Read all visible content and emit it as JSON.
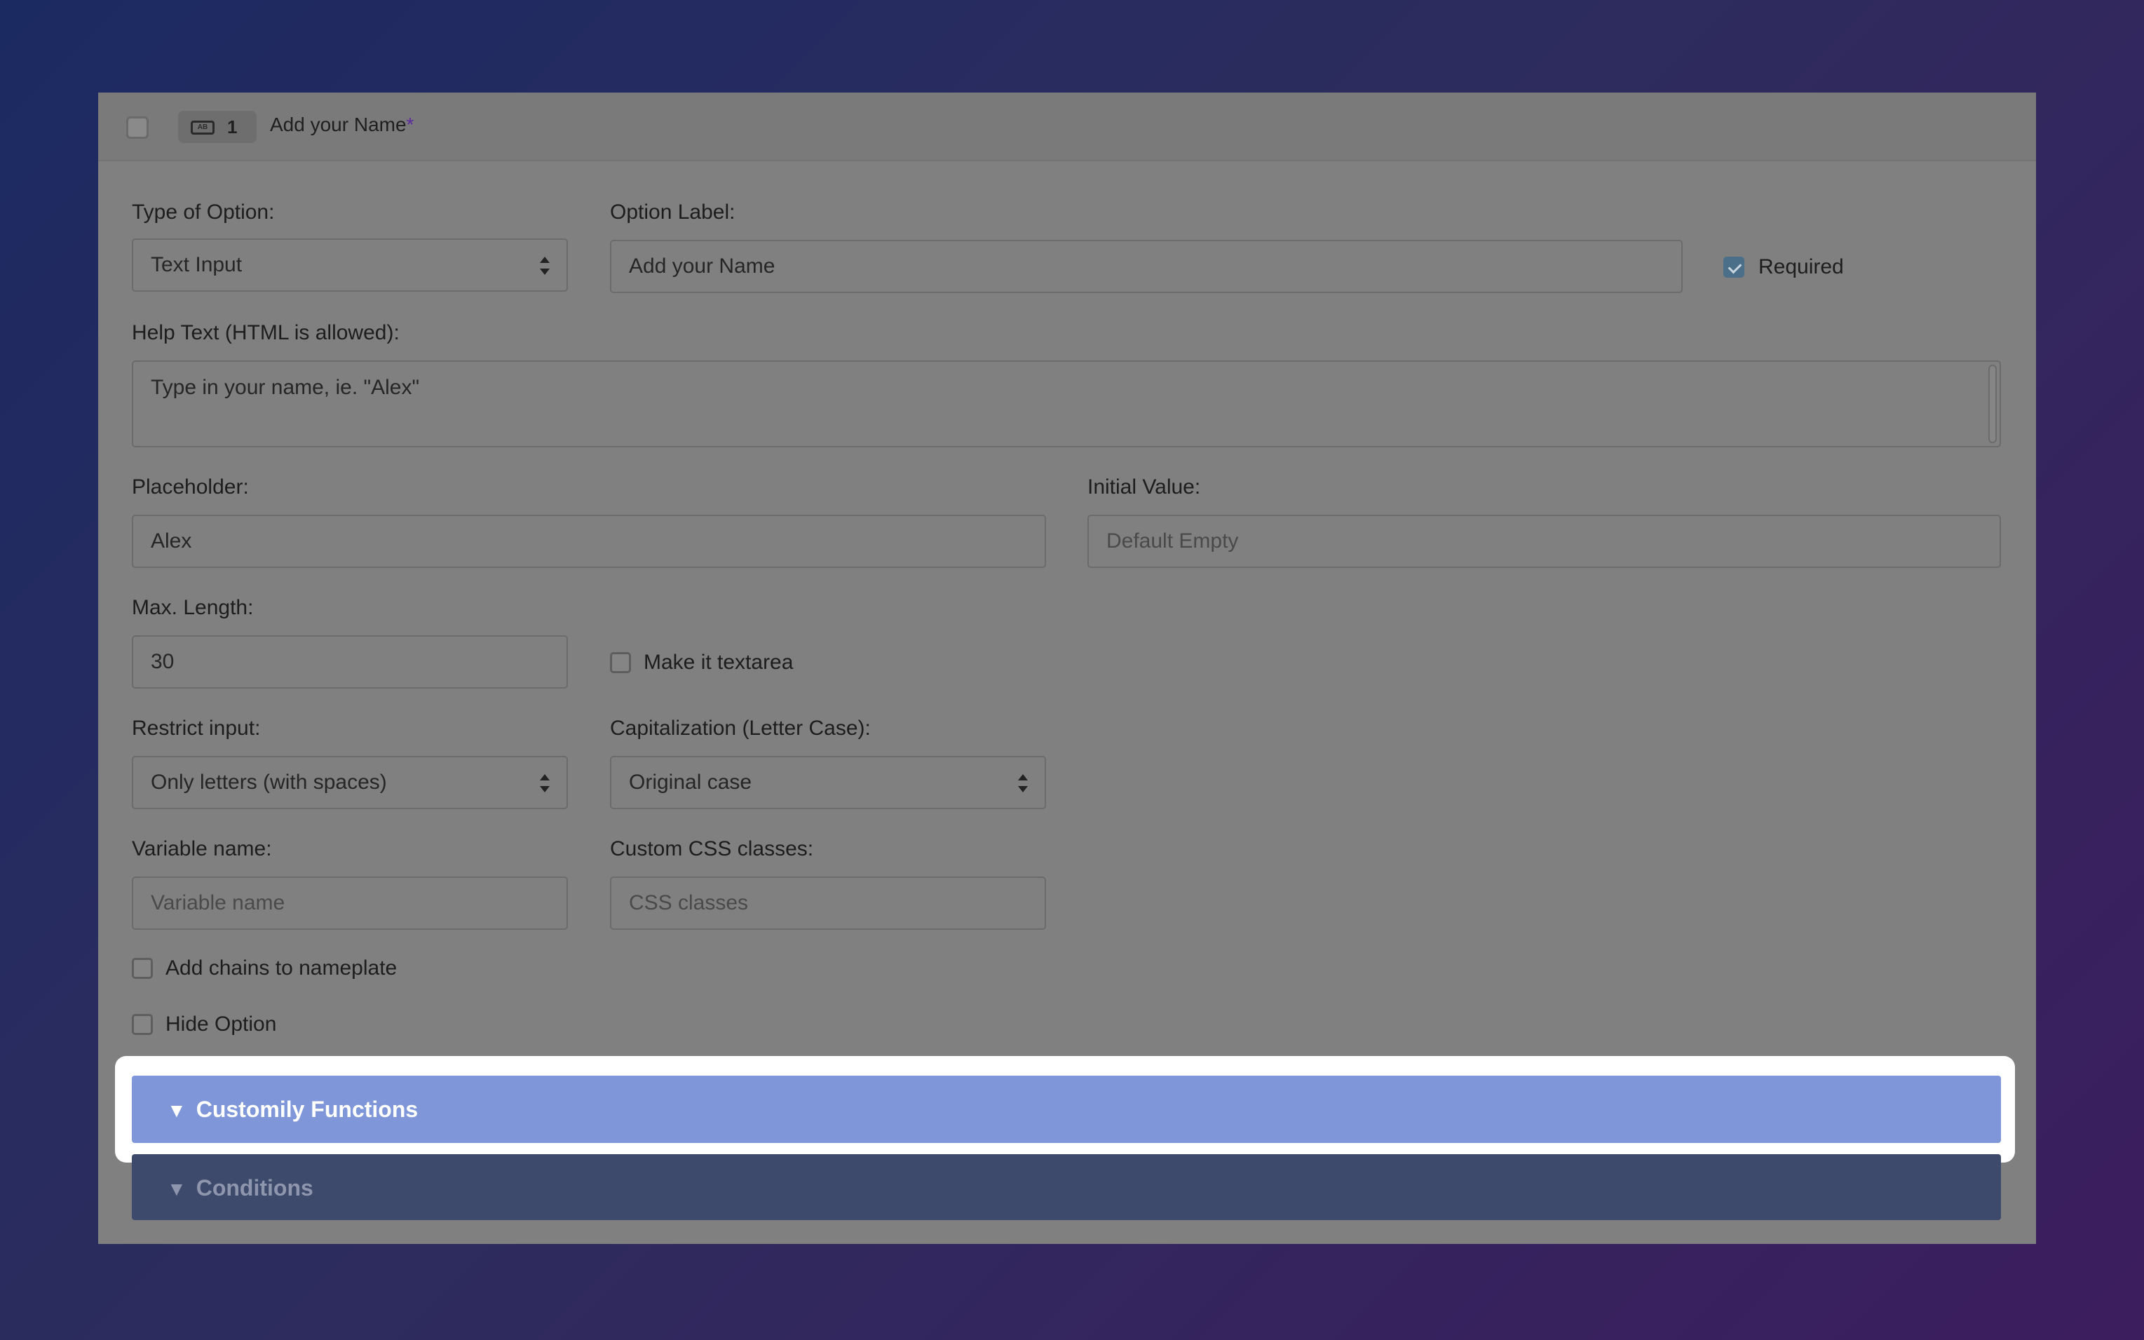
{
  "header": {
    "index": "1",
    "type_icon": "AB",
    "title": "Add your Name",
    "required_mark": "*"
  },
  "form": {
    "type_of_option": {
      "label": "Type of Option:",
      "value": "Text Input"
    },
    "option_label": {
      "label": "Option Label:",
      "value": "Add your Name"
    },
    "required": {
      "label": "Required",
      "checked": true
    },
    "help_text": {
      "label": "Help Text (HTML is allowed):",
      "value": "Type in your name, ie. \"Alex\""
    },
    "placeholder": {
      "label": "Placeholder:",
      "value": "Alex"
    },
    "initial_value": {
      "label": "Initial Value:",
      "placeholder": "Default Empty"
    },
    "max_length": {
      "label": "Max. Length:",
      "value": "30"
    },
    "make_textarea": {
      "label": "Make it textarea",
      "checked": false
    },
    "restrict_input": {
      "label": "Restrict input:",
      "value": "Only letters (with spaces)"
    },
    "capitalization": {
      "label": "Capitalization (Letter Case):",
      "value": "Original case"
    },
    "variable_name": {
      "label": "Variable name:",
      "placeholder": "Variable name"
    },
    "custom_css": {
      "label": "Custom CSS classes:",
      "placeholder": "CSS classes"
    },
    "add_chains": {
      "label": "Add chains to nameplate",
      "checked": false
    },
    "hide_option": {
      "label": "Hide Option",
      "checked": false
    }
  },
  "sections": {
    "customily_functions": "Customily Functions",
    "conditions": "Conditions",
    "arrow": "▼"
  },
  "colors": {
    "accent": "#7f97d8",
    "conditions_bar": "#3e4a6c",
    "highlight": "#ffffff"
  }
}
